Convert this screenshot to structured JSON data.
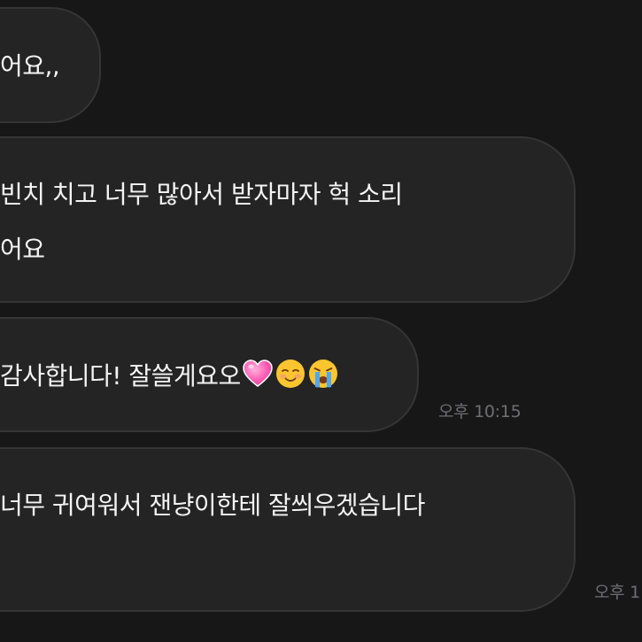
{
  "messages": [
    {
      "lines": [
        "어요,,"
      ]
    },
    {
      "lines": [
        "빈치 치고 너무 많아서 받자마자 헉 소리",
        "어요"
      ]
    },
    {
      "text": "감사합니다! 잘쓸게요오",
      "emojis": [
        "pink-heart-icon",
        "smiling-face-icon",
        "crying-face-icon"
      ],
      "time": "오후 10:15"
    },
    {
      "lines": [
        "너무 귀여워서 잰냥이한테 잘씌우겠습니다"
      ],
      "time": "오후 1"
    }
  ]
}
